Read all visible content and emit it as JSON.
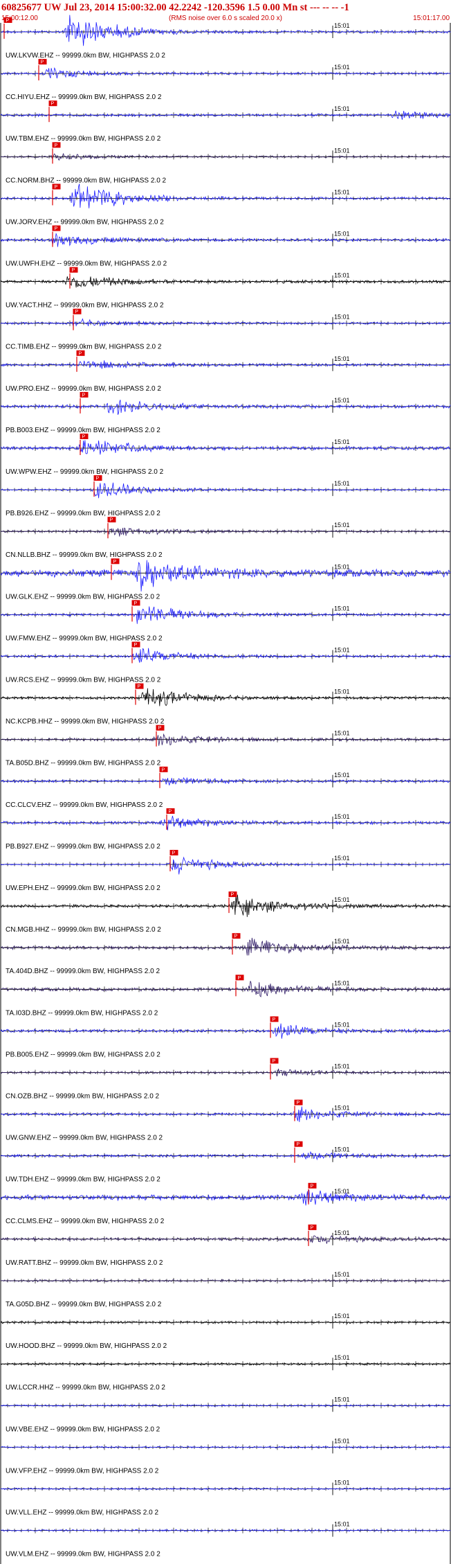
{
  "header": {
    "event_line": "60825677 UW Jul 23, 2014 15:00:32.00   42.2242  -120.3596  1.5 0.00 Mn st --- -- --  -1",
    "start_time": "15:00:12.00",
    "rms_note": "(RMS noise over 6.0 s scaled 20.0 x)",
    "end_time": "15:01:17.00",
    "minute_label": "15:01"
  },
  "colors": {
    "title": "#cc0000",
    "trace_blue": "#1a1aff",
    "trace_black": "#000000",
    "trace_purple": "#2e1a66",
    "pick": "#dd0000",
    "pick_text": "#ffffff",
    "axis": "#000000"
  },
  "chart_data": {
    "type": "line",
    "title": "60825677 UW Jul 23, 2014 15:00:32.00   42.2242  -120.3596  1.5 0.00 Mn st --- -- --  -1",
    "xlabel": "",
    "ylabel": "",
    "x_start": "15:00:12.00",
    "x_end": "15:01:17.00",
    "xlim_seconds": [
      0,
      65
    ],
    "minute_mark_seconds": 48,
    "pick_label": "P",
    "series": [
      {
        "name": "UW.LKVW.EHZ -- 99999.0km BW, HIGHPASS  2.0  2",
        "color": "blue",
        "pick_s": 0.5,
        "amp": 0.3,
        "burst_s": 10,
        "burst_amp": 2.2
      },
      {
        "name": "CC.HIYU.EHZ -- 99999.0km BW, HIGHPASS  2.0  2",
        "color": "blue",
        "pick_s": 5.5,
        "amp": 0.25,
        "burst_s": 7,
        "burst_amp": 0.6
      },
      {
        "name": "UW.TBM.EHZ -- 99999.0km BW, HIGHPASS  2.0  2",
        "color": "blue",
        "pick_s": 7.0,
        "amp": 0.3,
        "burst_s": 57,
        "burst_amp": 0.5
      },
      {
        "name": "CC.NORM.BHZ -- 99999.0km BW, HIGHPASS  2.0  2",
        "color": "purple",
        "pick_s": 7.5,
        "amp": 0.2,
        "burst_s": 8,
        "burst_amp": 0.4
      },
      {
        "name": "UW.JORV.EHZ -- 99999.0km BW, HIGHPASS  2.0  2",
        "color": "blue",
        "pick_s": 7.5,
        "amp": 0.3,
        "burst_s": 11,
        "burst_amp": 1.8
      },
      {
        "name": "UW.UWFH.EHZ -- 99999.0km BW, HIGHPASS  2.0  2",
        "color": "blue",
        "pick_s": 7.5,
        "amp": 0.35,
        "burst_s": 8,
        "burst_amp": 0.7
      },
      {
        "name": "UW.YACT.HHZ -- 99999.0km BW, HIGHPASS  2.0  2",
        "color": "black",
        "pick_s": 10.0,
        "amp": 0.35,
        "burst_s": 10,
        "burst_amp": 0.9
      },
      {
        "name": "CC.TIMB.EHZ -- 99999.0km BW, HIGHPASS  2.0  2",
        "color": "blue",
        "pick_s": 10.5,
        "amp": 0.25,
        "burst_s": 11,
        "burst_amp": 0.4
      },
      {
        "name": "UW.PRO.EHZ -- 99999.0km BW, HIGHPASS  2.0  2",
        "color": "blue",
        "pick_s": 11.0,
        "amp": 0.3,
        "burst_s": 12,
        "burst_amp": 0.6
      },
      {
        "name": "PB.B003.EHZ -- 99999.0km BW, HIGHPASS  2.0  2",
        "color": "blue",
        "pick_s": 11.5,
        "amp": 0.4,
        "burst_s": 16,
        "burst_amp": 0.9
      },
      {
        "name": "UW.WPW.EHZ -- 99999.0km BW, HIGHPASS  2.0  2",
        "color": "blue",
        "pick_s": 11.5,
        "amp": 0.4,
        "burst_s": 12,
        "burst_amp": 1.2
      },
      {
        "name": "PB.B926.EHZ -- 99999.0km BW, HIGHPASS  2.0  2",
        "color": "blue",
        "pick_s": 13.5,
        "amp": 0.2,
        "burst_s": 14,
        "burst_amp": 1.1
      },
      {
        "name": "CN.NLLB.BHZ -- 99999.0km BW, HIGHPASS  2.0  2",
        "color": "purple",
        "pick_s": 15.5,
        "amp": 0.25,
        "burst_s": 16,
        "burst_amp": 0.6
      },
      {
        "name": "UW.GLK.EHZ -- 99999.0km BW, HIGHPASS  2.0  2",
        "color": "blue",
        "pick_s": 16.0,
        "amp": 0.9,
        "burst_s": 20,
        "burst_amp": 1.8
      },
      {
        "name": "UW.FMW.EHZ -- 99999.0km BW, HIGHPASS  2.0  2",
        "color": "blue",
        "pick_s": 19.0,
        "amp": 0.3,
        "burst_s": 20,
        "burst_amp": 1.4
      },
      {
        "name": "UW.RCS.EHZ -- 99999.0km BW, HIGHPASS  2.0  2",
        "color": "blue",
        "pick_s": 19.0,
        "amp": 0.3,
        "burst_s": 20,
        "burst_amp": 1.0
      },
      {
        "name": "NC.KCPB.HHZ -- 99999.0km BW, HIGHPASS  2.0  2",
        "color": "black",
        "pick_s": 19.5,
        "amp": 0.3,
        "burst_s": 21,
        "burst_amp": 1.2
      },
      {
        "name": "TA.B05D.BHZ -- 99999.0km BW, HIGHPASS  2.0  2",
        "color": "purple",
        "pick_s": 22.5,
        "amp": 0.3,
        "burst_s": 23,
        "burst_amp": 0.8
      },
      {
        "name": "CC.CLCV.EHZ -- 99999.0km BW, HIGHPASS  2.0  2",
        "color": "blue",
        "pick_s": 23.0,
        "amp": 0.3,
        "burst_s": 24,
        "burst_amp": 0.5
      },
      {
        "name": "PB.B927.EHZ -- 99999.0km BW, HIGHPASS  2.0  2",
        "color": "blue",
        "pick_s": 24.0,
        "amp": 0.35,
        "burst_s": 24,
        "burst_amp": 0.8
      },
      {
        "name": "UW.EPH.EHZ -- 99999.0km BW, HIGHPASS  2.0  2",
        "color": "blue",
        "pick_s": 24.5,
        "amp": 0.15,
        "burst_s": 25,
        "burst_amp": 1.2
      },
      {
        "name": "CN.MGB.HHZ -- 99999.0km BW, HIGHPASS  2.0  2",
        "color": "black",
        "pick_s": 33.0,
        "amp": 0.35,
        "burst_s": 34,
        "burst_amp": 1.3
      },
      {
        "name": "TA.404D.BHZ -- 99999.0km BW, HIGHPASS  2.0  2",
        "color": "purple",
        "pick_s": 33.5,
        "amp": 0.4,
        "burst_s": 36,
        "burst_amp": 1.2
      },
      {
        "name": "TA.I03D.BHZ -- 99999.0km BW, HIGHPASS  2.0  2",
        "color": "purple",
        "pick_s": 34.0,
        "amp": 0.4,
        "burst_s": 36,
        "burst_amp": 1.0
      },
      {
        "name": "PB.B005.EHZ -- 99999.0km BW, HIGHPASS  2.0  2",
        "color": "blue",
        "pick_s": 39.0,
        "amp": 0.35,
        "burst_s": 40,
        "burst_amp": 0.8
      },
      {
        "name": "CN.OZB.BHZ -- 99999.0km BW, HIGHPASS  2.0  2",
        "color": "purple",
        "pick_s": 39.0,
        "amp": 0.25,
        "burst_s": 40,
        "burst_amp": 0.4
      },
      {
        "name": "UW.GNW.EHZ -- 99999.0km BW, HIGHPASS  2.0  2",
        "color": "blue",
        "pick_s": 42.5,
        "amp": 0.3,
        "burst_s": 43,
        "burst_amp": 0.8
      },
      {
        "name": "UW.TDH.EHZ -- 99999.0km BW, HIGHPASS  2.0  2",
        "color": "blue",
        "pick_s": 42.5,
        "amp": 0.3,
        "burst_s": 44,
        "burst_amp": 0.5
      },
      {
        "name": "CC.CLMS.EHZ -- 99999.0km BW, HIGHPASS  2.0  2",
        "color": "blue",
        "pick_s": 44.5,
        "amp": 0.6,
        "burst_s": 44,
        "burst_amp": 0.8
      },
      {
        "name": "UW.RATT.BHZ -- 99999.0km BW, HIGHPASS  2.0  2",
        "color": "purple",
        "pick_s": 44.5,
        "amp": 0.35,
        "burst_s": 45,
        "burst_amp": 0.5
      },
      {
        "name": "TA.G05D.BHZ -- 99999.0km BW, HIGHPASS  2.0  2",
        "color": "purple",
        "pick_s": null,
        "amp": 0.25,
        "burst_s": null,
        "burst_amp": 0
      },
      {
        "name": "UW.HOOD.BHZ -- 99999.0km BW, HIGHPASS  2.0  2",
        "color": "black",
        "pick_s": null,
        "amp": 0.25,
        "burst_s": null,
        "burst_amp": 0
      },
      {
        "name": "UW.LCCR.HHZ -- 99999.0km BW, HIGHPASS  2.0  2",
        "color": "black",
        "pick_s": null,
        "amp": 0.25,
        "burst_s": null,
        "burst_amp": 0
      },
      {
        "name": "UW.VBE.EHZ -- 99999.0km BW, HIGHPASS  2.0  2",
        "color": "blue",
        "pick_s": null,
        "amp": 0.2,
        "burst_s": null,
        "burst_amp": 0
      },
      {
        "name": "UW.VFP.EHZ -- 99999.0km BW, HIGHPASS  2.0  2",
        "color": "blue",
        "pick_s": null,
        "amp": 0.2,
        "burst_s": null,
        "burst_amp": 0
      },
      {
        "name": "UW.VLL.EHZ -- 99999.0km BW, HIGHPASS  2.0  2",
        "color": "blue",
        "pick_s": null,
        "amp": 0.2,
        "burst_s": null,
        "burst_amp": 0
      },
      {
        "name": "UW.VLM.EHZ -- 99999.0km BW, HIGHPASS  2.0  2",
        "color": "blue",
        "pick_s": null,
        "amp": 0.2,
        "burst_s": null,
        "burst_amp": 0
      }
    ]
  }
}
